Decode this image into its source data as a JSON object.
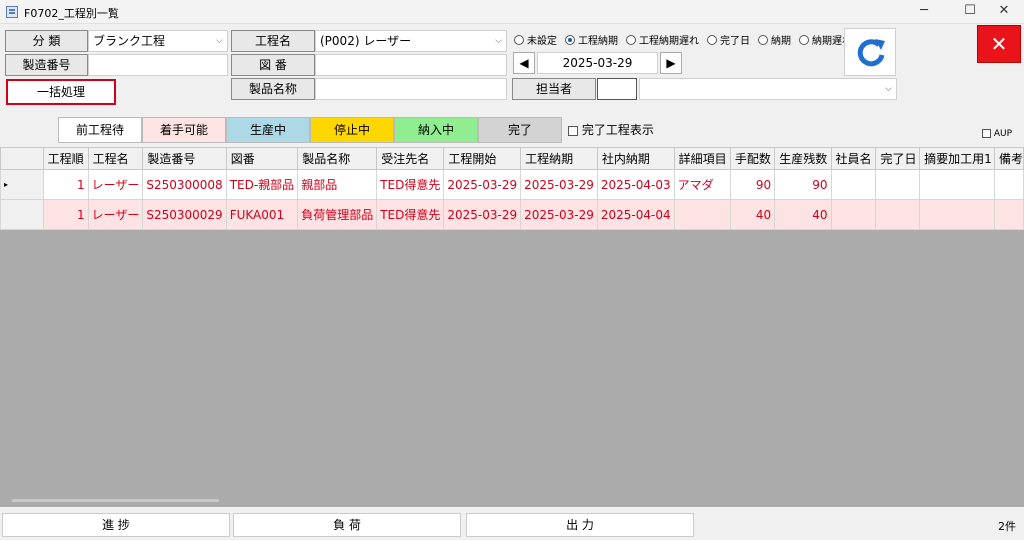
{
  "window": {
    "title": "F0702_工程別一覧",
    "minimize": "─",
    "maximize": "☐",
    "close": "✕"
  },
  "filters": {
    "category_label": "分 類",
    "category_value": "ブランク工程",
    "process_label": "工程名",
    "process_value": "(P002) レーザー",
    "mfg_no_label": "製造番号",
    "mfg_no_value": "",
    "drawing_label": "図 番",
    "drawing_value": "",
    "product_label": "製品名称",
    "product_value": "",
    "staff_label": "担当者",
    "staff_code": "",
    "staff_name": "",
    "date_value": "2025-03-29",
    "prev": "◀",
    "next": "▶",
    "radios": [
      {
        "label": "未設定",
        "selected": false
      },
      {
        "label": "工程納期",
        "selected": true
      },
      {
        "label": "工程納期遅れ",
        "selected": false
      },
      {
        "label": "完了日",
        "selected": false
      },
      {
        "label": "納期",
        "selected": false
      },
      {
        "label": "納期遅れ",
        "selected": false
      }
    ]
  },
  "batch_label": "一括処理",
  "close_x": "✕",
  "tabs": [
    {
      "label": "前工程待",
      "color": "#ffffff"
    },
    {
      "label": "着手可能",
      "color": "#fde3e3"
    },
    {
      "label": "生産中",
      "color": "#add8e6"
    },
    {
      "label": "停止中",
      "color": "#ffd700"
    },
    {
      "label": "納入中",
      "color": "#90ee90"
    },
    {
      "label": "完了",
      "color": "#d3d3d3"
    }
  ],
  "show_completed_label": "完了工程表示",
  "aup_label": "AUP",
  "table": {
    "columns": [
      "",
      "工程順",
      "工程名",
      "製造番号",
      "図番",
      "製品名称",
      "受注先名",
      "工程開始",
      "工程納期",
      "社内納期",
      "詳細項目",
      "手配数",
      "生産残数",
      "社員名",
      "完了日",
      "摘要加工用1",
      "備考"
    ],
    "rows": [
      {
        "marker": "▸",
        "cells": [
          "1",
          "レーザー",
          "S250300008",
          "TED-親部品",
          "親部品",
          "TED得意先",
          "2025-03-29",
          "2025-03-29",
          "2025-04-03",
          "アマダ",
          "90",
          "90",
          "",
          "",
          "",
          ""
        ]
      },
      {
        "marker": "",
        "cells": [
          "1",
          "レーザー",
          "S250300029",
          "FUKA001",
          "負荷管理部品",
          "TED得意先",
          "2025-03-29",
          "2025-03-29",
          "2025-04-04",
          "",
          "40",
          "40",
          "",
          "",
          "",
          ""
        ]
      }
    ]
  },
  "footer": {
    "progress": "進 捗",
    "load": "負 荷",
    "output": "出 力",
    "count": "2件"
  },
  "colors": {
    "accent_red": "#d0021b",
    "refresh_blue": "#1f6fd0"
  }
}
